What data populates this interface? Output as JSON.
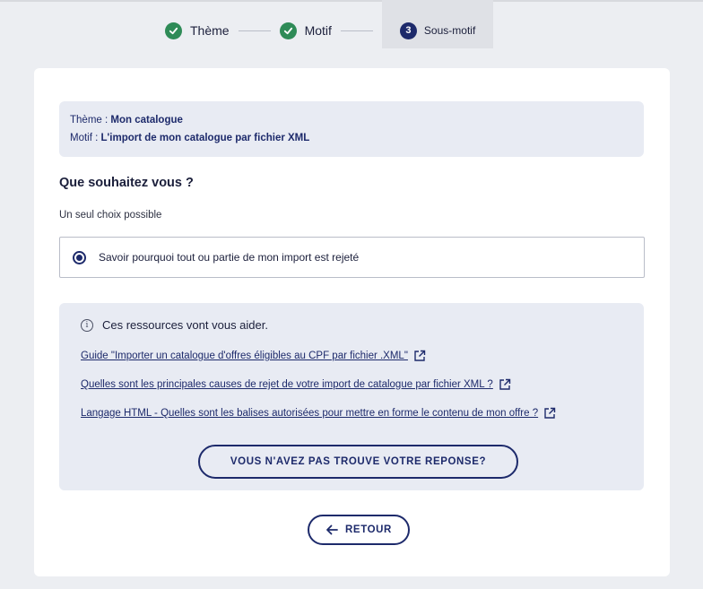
{
  "stepper": {
    "steps": [
      {
        "label": "Thème",
        "state": "done"
      },
      {
        "label": "Motif",
        "state": "done"
      },
      {
        "label": "Sous-motif",
        "state": "active",
        "number": "3"
      }
    ]
  },
  "context": {
    "theme_label": "Thème : ",
    "theme_value": "Mon catalogue",
    "motif_label": "Motif : ",
    "motif_value": "L'import de mon catalogue par fichier XML"
  },
  "question": {
    "title": "Que souhaitez vous ?",
    "hint": "Un seul choix possible",
    "options": [
      {
        "label": "Savoir pourquoi tout ou partie de mon import est rejeté",
        "selected": true
      }
    ]
  },
  "resources": {
    "header": "Ces ressources vont vous aider.",
    "links": [
      "Guide \"Importer un catalogue d'offres éligibles au CPF par fichier .XML\"",
      "Quelles sont les principales causes de rejet de votre import de catalogue par fichier XML ?",
      "Langage HTML - Quelles sont les balises autorisées pour mettre en forme le contenu de mon offre ?"
    ],
    "not_found_button": "VOUS N'AVEZ PAS TROUVE VOTRE REPONSE?"
  },
  "back_button": "RETOUR",
  "colors": {
    "primary": "#1d2a6b",
    "success": "#2e8b57",
    "page_bg": "#eceef2",
    "panel_bg": "#e8ebf3"
  }
}
